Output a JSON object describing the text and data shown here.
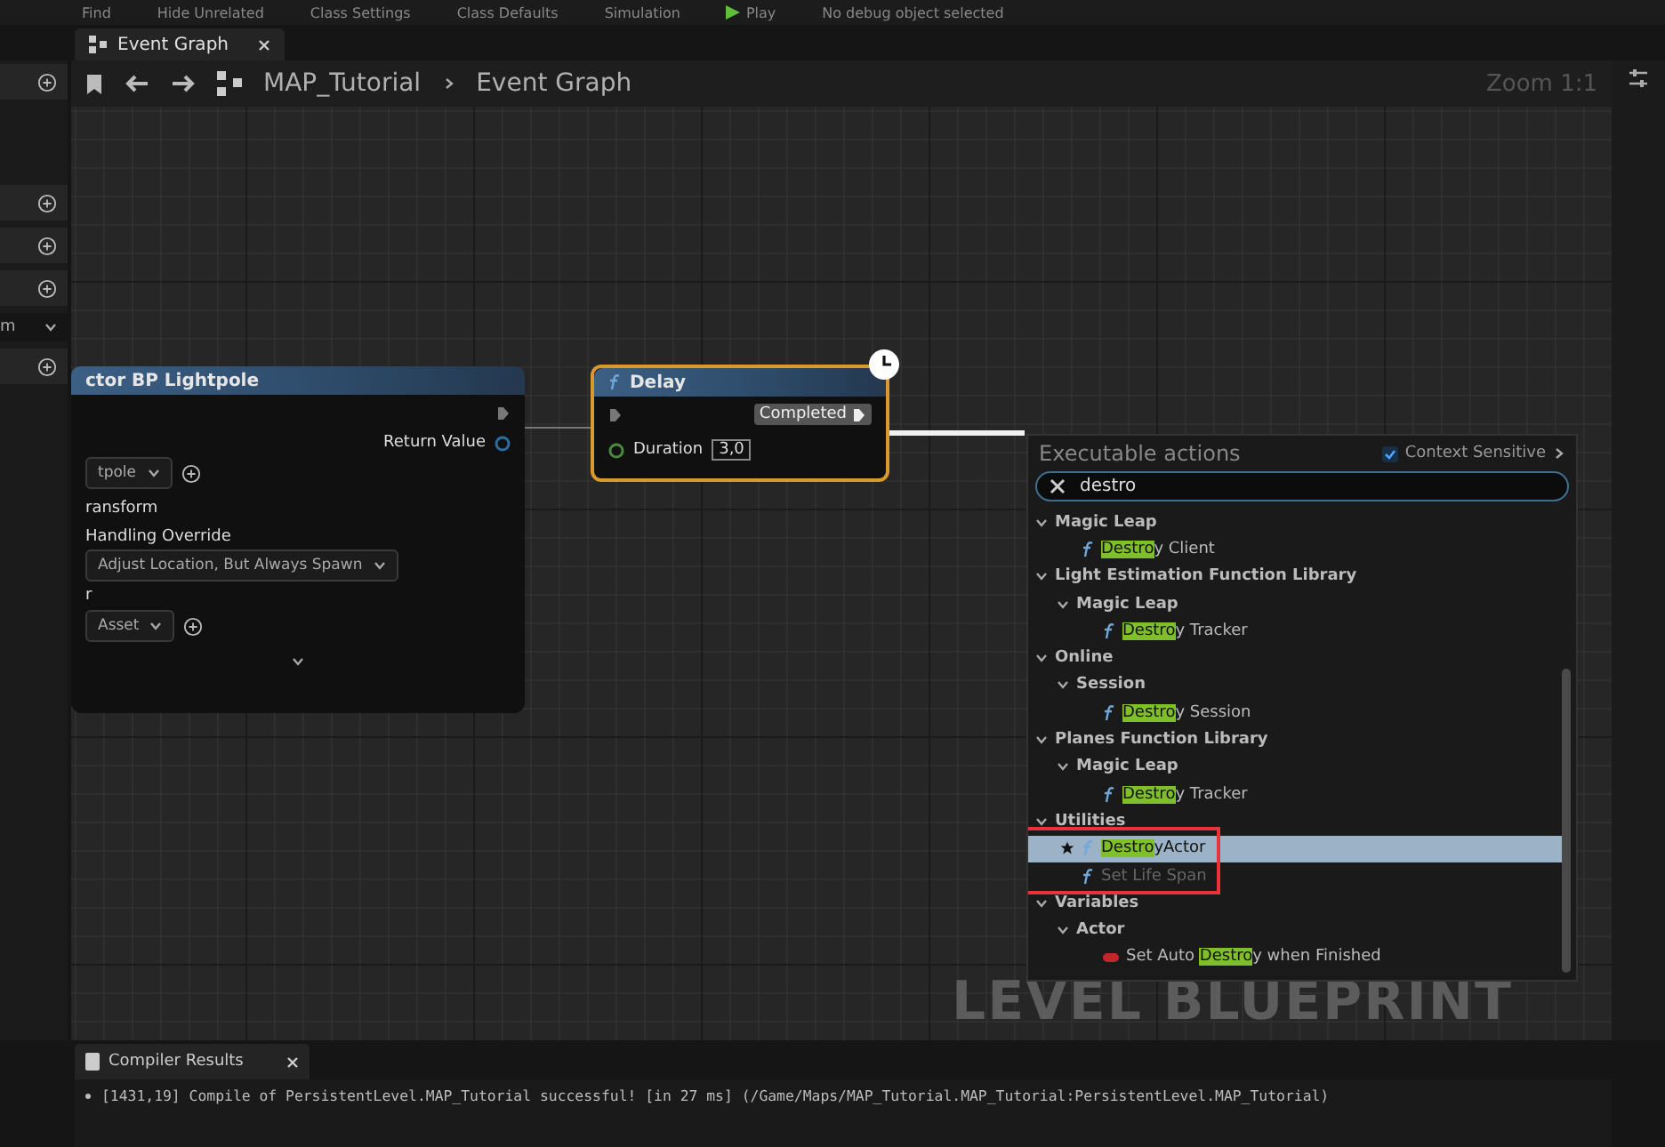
{
  "toolbar": [
    "Find",
    "Hide Unrelated",
    "Class Settings",
    "Class Defaults",
    "Simulation",
    "Play",
    "No debug object selected"
  ],
  "tabs": [
    {
      "label": "Event Graph",
      "selected": true
    }
  ],
  "left_panel": {
    "rows": [
      {
        "kind": "add"
      },
      {
        "kind": "spacer"
      },
      {
        "kind": "add"
      },
      {
        "kind": "add"
      },
      {
        "kind": "add"
      },
      {
        "kind": "section",
        "label": "m"
      },
      {
        "kind": "add"
      }
    ]
  },
  "breadcrumb": {
    "items": [
      "MAP_Tutorial",
      "Event Graph"
    ],
    "zoom": "Zoom 1:1"
  },
  "spawn_node": {
    "title": "ctor BP Lightpole",
    "return_label": "Return Value",
    "class_value": "tpole",
    "transform_label": "ransform",
    "handling_label": "Handling Override",
    "handling_value": "Adjust Location, But Always Spawn",
    "owner_label": "r",
    "asset_value": "Asset"
  },
  "delay_node": {
    "title": "Delay",
    "out_label": "Completed",
    "duration_label": "Duration",
    "duration_value": "3,0"
  },
  "watermark": "LEVEL BLUEPRINT",
  "action_menu": {
    "title": "Executable actions",
    "context_sensitive": {
      "label": "Context Sensitive",
      "checked": true
    },
    "search": {
      "value": "destro"
    },
    "items": [
      {
        "kind": "category",
        "label": "Magic Leap",
        "expanded": true,
        "children": [
          {
            "kind": "function",
            "match": "Destro",
            "rest": "y Client",
            "selected": false
          }
        ]
      },
      {
        "kind": "category",
        "label": "Light Estimation Function Library",
        "expanded": true,
        "children": [
          {
            "kind": "category",
            "label": "Magic Leap",
            "expanded": true,
            "children": [
              {
                "kind": "function",
                "match": "Destro",
                "rest": "y Tracker",
                "selected": false
              }
            ]
          }
        ]
      },
      {
        "kind": "category",
        "label": "Online",
        "expanded": true,
        "children": [
          {
            "kind": "category",
            "label": "Session",
            "expanded": true,
            "children": [
              {
                "kind": "function",
                "match": "Destro",
                "rest": "y Session",
                "selected": false
              }
            ]
          }
        ]
      },
      {
        "kind": "category",
        "label": "Planes Function Library",
        "expanded": true,
        "children": [
          {
            "kind": "category",
            "label": "Magic Leap",
            "expanded": true,
            "children": [
              {
                "kind": "function",
                "match": "Destro",
                "rest": "y Tracker",
                "selected": false
              }
            ]
          }
        ]
      },
      {
        "kind": "category",
        "label": "Utilities",
        "expanded": true,
        "children": [
          {
            "kind": "function",
            "match": "Destro",
            "rest": "yActor",
            "selected": true,
            "favorite": true,
            "marked": true
          },
          {
            "kind": "function",
            "rest": "Set Life Span",
            "selected": false
          }
        ]
      },
      {
        "kind": "category",
        "label": "Variables",
        "expanded": true,
        "children": [
          {
            "kind": "category",
            "label": "Actor",
            "expanded": true,
            "children": [
              {
                "kind": "variable",
                "before": "Set Auto ",
                "match": "Destro",
                "rest": "y when Finished",
                "selected": false
              }
            ]
          }
        ]
      }
    ]
  },
  "compiler_results": {
    "tab": "Compiler Results",
    "lines": [
      "[1431,19] Compile of PersistentLevel.MAP_Tutorial successful! [in 27 ms] (/Game/Maps/MAP_Tutorial.MAP_Tutorial:PersistentLevel.MAP_Tutorial)"
    ]
  }
}
